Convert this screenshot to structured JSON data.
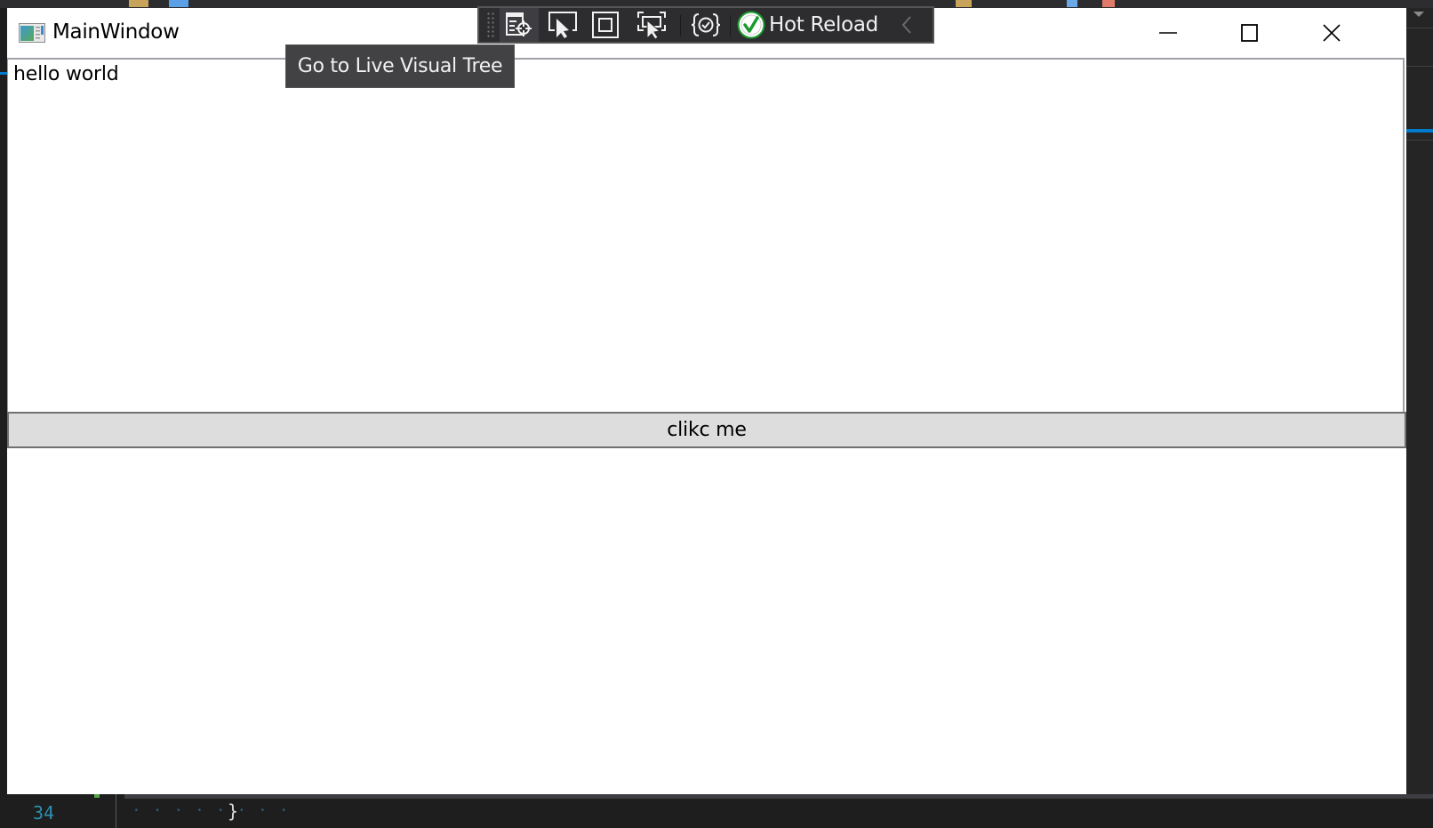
{
  "window": {
    "title": "MainWindow",
    "icon": "wpf-window-icon",
    "controls": {
      "minimize": "minimize-icon",
      "maximize": "maximize-icon",
      "close": "close-icon"
    }
  },
  "content": {
    "textblock": "hello world",
    "button_label": "clikc me"
  },
  "xaml_toolbar": {
    "buttons": [
      {
        "name": "go-to-live-visual-tree",
        "icon": "live-visual-tree-icon",
        "active": true
      },
      {
        "name": "select-element",
        "icon": "select-element-icon"
      },
      {
        "name": "display-layout-adorners",
        "icon": "layout-adorners-icon"
      },
      {
        "name": "track-focused-element",
        "icon": "track-focus-icon"
      },
      {
        "name": "binding-failures",
        "icon": "binding-check-icon"
      }
    ],
    "hot_reload_label": "Hot Reload",
    "hot_reload_status": "ok",
    "collapse_icon": "chevron-left-icon",
    "colors": {
      "background": "#2d2d30",
      "status_green": "#1a9a2e"
    }
  },
  "tooltip": {
    "text": "Go to Live Visual Tree"
  },
  "editor_background": {
    "line_number": "34",
    "code_text": "}"
  }
}
